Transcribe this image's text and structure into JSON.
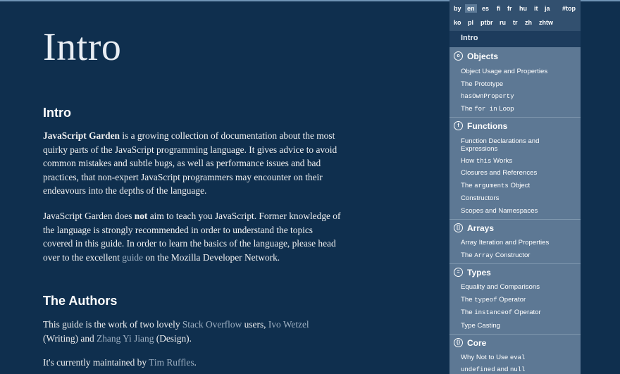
{
  "main": {
    "title": "Intro",
    "intro_heading": "Intro",
    "p1_bold": "JavaScript Garden",
    "p1_rest": " is a growing collection of documentation about the most quirky parts of the JavaScript programming language. It gives advice to avoid common mistakes and subtle bugs, as well as performance issues and bad practices, that non-expert JavaScript programmers may encounter on their endeavours into the depths of the language.",
    "p2_a": "JavaScript Garden does ",
    "p2_bold": "not",
    "p2_b": " aim to teach you JavaScript. Former knowledge of the language is strongly recommended in order to understand the topics covered in this guide. In order to learn the basics of the language, please head over to the excellent ",
    "p2_link": "guide",
    "p2_c": " on the Mozilla Developer Network.",
    "authors_heading": "The Authors",
    "p3_a": "This guide is the work of two lovely ",
    "p3_link1": "Stack Overflow",
    "p3_b": " users, ",
    "p3_link2": "Ivo Wetzel",
    "p3_c": " (Writing) and ",
    "p3_link3": "Zhang Yi Jiang",
    "p3_d": " (Design).",
    "p4_a": "It's currently maintained by ",
    "p4_link": "Tim Ruffles",
    "p4_b": "."
  },
  "languages": {
    "row1": [
      "by",
      "en",
      "es",
      "fi",
      "fr",
      "hu",
      "it",
      "ja"
    ],
    "top": "#top",
    "row2": [
      "ko",
      "pl",
      "ptbr",
      "ru",
      "tr",
      "zh",
      "zhtw"
    ],
    "active": "en"
  },
  "nav": {
    "current": "Intro",
    "objects": {
      "title": "Objects",
      "icon": "o",
      "items": [
        "Object Usage and Properties",
        "The Prototype",
        "hasOwnProperty"
      ],
      "for_in": {
        "a": "The ",
        "code": "for in",
        "b": " Loop"
      }
    },
    "functions": {
      "title": "Functions",
      "icon": "f",
      "items": [
        "Function Declarations and Expressions"
      ],
      "how_this": {
        "a": "How ",
        "code": "this",
        "b": " Works"
      },
      "closures": "Closures and References",
      "arguments": {
        "a": "The ",
        "code": "arguments",
        "b": " Object"
      },
      "constructors": "Constructors",
      "scopes": "Scopes and Namespaces"
    },
    "arrays": {
      "title": "Arrays",
      "icon": "[]",
      "iteration": "Array Iteration and Properties",
      "ctor": {
        "a": "The ",
        "code": "Array",
        "b": " Constructor"
      }
    },
    "types": {
      "title": "Types",
      "icon": "=",
      "equality": "Equality and Comparisons",
      "typeof": {
        "a": "The ",
        "code": "typeof",
        "b": " Operator"
      },
      "instanceof": {
        "a": "The ",
        "code": "instanceof",
        "b": " Operator"
      },
      "casting": "Type Casting"
    },
    "core": {
      "title": "Core",
      "icon": "{}",
      "eval": {
        "a": "Why Not to Use ",
        "code": "eval"
      },
      "undef": {
        "code1": "undefined",
        "a": " and ",
        "code2": "null"
      }
    }
  }
}
